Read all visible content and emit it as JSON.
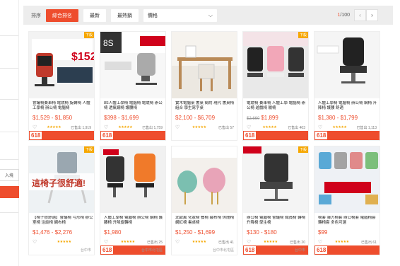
{
  "sort_bar": {
    "label": "排序",
    "buttons": [
      {
        "label": "綜合排名",
        "active": true
      },
      {
        "label": "最新",
        "active": false
      },
      {
        "label": "最熱銷",
        "active": false
      }
    ],
    "price_select": "價格",
    "pager": {
      "current": "1",
      "total": "/100"
    }
  },
  "sidebar": {
    "input_text": "入境"
  },
  "accent_color": "#ee4d2d",
  "products": [
    {
      "title": "會議椅賽車椅 電競椅 旋轉椅 人體工學椅 辦公椅 電腦椅",
      "price": "$1,529 - $1,850",
      "orig": "",
      "sold": "已售出 1,919",
      "loc": "",
      "badge": "",
      "hot": "下殺",
      "sale618": true
    },
    {
      "title": "8S人體工學椅 電腦椅 電競椅 辦公椅 透氣網椅 護腰椅",
      "price": "$398 - $1,699",
      "orig": "",
      "sold": "已售出 1,759",
      "loc": "",
      "badge": "",
      "hot": "",
      "sale618": true
    },
    {
      "title": "實木電腦桌 書桌 簡約 現代 書桌椅組合 學生寫字桌",
      "price": "$2,100 - $6,709",
      "orig": "",
      "sold": "已售出 57",
      "loc": "",
      "badge": "",
      "hot": "",
      "sale618": false
    },
    {
      "title": "電競椅 賽車椅 人體工學 電腦椅 辦公椅 遊戲椅 躺椅",
      "price": "$1,899",
      "orig": "$2,660",
      "sold": "已售出 403",
      "loc": "",
      "badge": "",
      "hot": "下殺",
      "sale618": true
    },
    {
      "title": "人體工學椅 電腦椅 辦公椅 網椅 升降椅 護腰 舒適",
      "price": "$1,380 - $1,799",
      "orig": "",
      "sold": "已售出 1,113",
      "loc": "",
      "badge": "",
      "hot": "",
      "sale618": true
    },
    {
      "title": "【椅子很舒適】會議椅 弓形椅 辦公室椅 洽談椅 網布椅",
      "price": "$1,476 - $2,276",
      "orig": "",
      "sold": "",
      "loc": "台中市",
      "badge": "",
      "hot": "下殺",
      "sale618": false
    },
    {
      "title": "人體工學椅 電腦椅 辦公椅 網椅 護腰椅 升降旋轉椅",
      "price": "$1,980",
      "orig": "",
      "sold": "已售出 25",
      "loc": "台中市北屯區",
      "badge": "",
      "hot": "",
      "sale618": true
    },
    {
      "title": "北歐風 化妝椅 餐椅 絨布椅 休閒椅 網紅椅 書桌椅",
      "price": "$1,250 - $1,699",
      "orig": "",
      "sold": "已售出 41",
      "loc": "台中市北屯區",
      "badge": "",
      "hot": "",
      "sale618": false
    },
    {
      "title": "辦公椅 電腦椅 會議椅 職員椅 轉椅 升降椅 學生椅",
      "price": "$130 - $180",
      "orig": "",
      "sold": "已售出 20",
      "loc": "台中市",
      "badge": "",
      "hot": "下殺",
      "sale618": true
    },
    {
      "title": "椅套 彈力椅套 辦公椅套 電腦椅套 轉椅套 多色可選",
      "price": "$99",
      "orig": "",
      "sold": "已售出 61",
      "loc": "",
      "badge": "",
      "hot": "",
      "sale618": true
    }
  ]
}
